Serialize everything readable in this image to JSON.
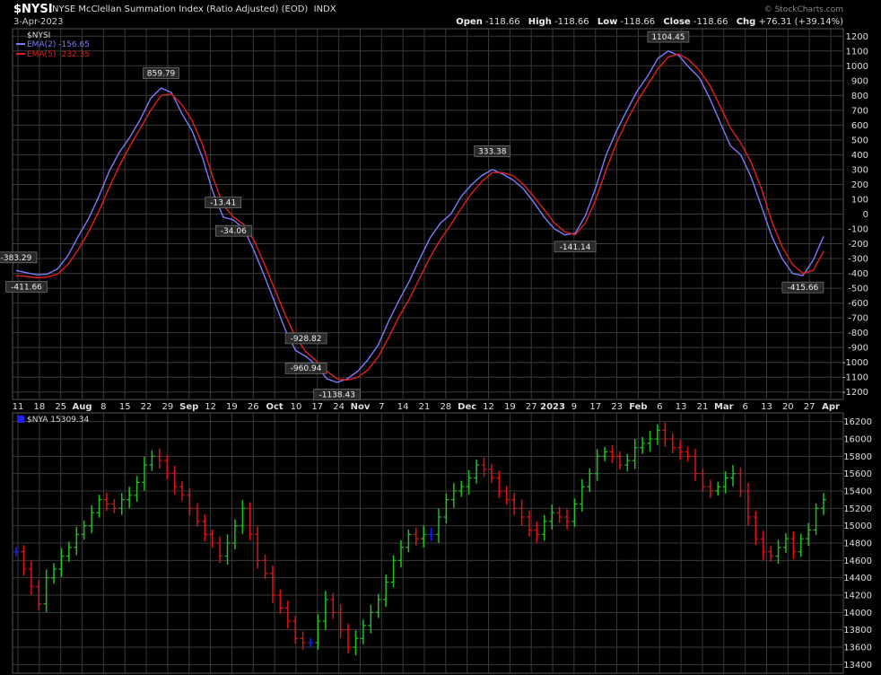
{
  "header": {
    "symbol": "$NYSI",
    "title": "NYSE McClellan Summation Index (Ratio Adjusted) (EOD)",
    "exchange": "INDX",
    "date": "3-Apr-2023",
    "brand": "© StockCharts.com",
    "ohlc": {
      "open_label": "Open",
      "open": "-118.66",
      "high_label": "High",
      "high": "-118.66",
      "low_label": "Low",
      "low": "-118.66",
      "close_label": "Close",
      "close": "-118.66",
      "chg_label": "Chg",
      "chg": "+76.31 (+39.14%)"
    }
  },
  "colors": {
    "background": "#000000",
    "grid": "#3a3a3a",
    "ema2": "#7b7bff",
    "ema5": "#e02020",
    "bar_up": "#20c020",
    "bar_down": "#e01010",
    "bar_neutral": "#2020ff"
  },
  "chart_data": [
    {
      "type": "line",
      "legend": [
        "$NYSI",
        "EMA(2) -156.65",
        "EMA(5) -232.35"
      ],
      "legend_position": "top-left",
      "grid": true,
      "ylim": [
        -1250,
        1250
      ],
      "yticks": [
        1200,
        1100,
        1000,
        900,
        800,
        700,
        600,
        500,
        400,
        300,
        200,
        100,
        0,
        -100,
        -200,
        -300,
        -400,
        -500,
        -600,
        -700,
        -800,
        -900,
        -1000,
        -1100,
        -1200
      ],
      "xticks": [
        "11",
        "18",
        "25",
        "Aug",
        "8",
        "15",
        "22",
        "29",
        "Sep",
        "12",
        "19",
        "26",
        "Oct",
        "10",
        "17",
        "24",
        "Nov",
        "7",
        "14",
        "21",
        "28",
        "Dec",
        "12",
        "19",
        "27",
        "2023",
        "9",
        "17",
        "23",
        "Feb",
        "6",
        "13",
        "21",
        "Mar",
        "6",
        "13",
        "20",
        "27",
        "Apr"
      ],
      "series": [
        {
          "name": "EMA(2)",
          "color": "#7b7bff",
          "values": [
            -380,
            -395,
            -410,
            -405,
            -370,
            -280,
            -150,
            -30,
            120,
            290,
            420,
            520,
            640,
            780,
            850,
            820,
            680,
            560,
            380,
            150,
            -20,
            -40,
            -100,
            -250,
            -420,
            -600,
            -780,
            -920,
            -960,
            -1020,
            -1110,
            -1135,
            -1110,
            -1060,
            -980,
            -880,
            -720,
            -580,
            -450,
            -300,
            -160,
            -60,
            0,
            120,
            200,
            260,
            300,
            270,
            230,
            170,
            80,
            -20,
            -100,
            -140,
            -130,
            -10,
            180,
            400,
            560,
            700,
            830,
            930,
            1050,
            1100,
            1070,
            990,
            920,
            780,
            620,
            460,
            400,
            250,
            50,
            -150,
            -300,
            -400,
            -415,
            -310,
            -150
          ]
        },
        {
          "name": "EMA(5)",
          "color": "#e02020",
          "values": [
            -415,
            -420,
            -430,
            -425,
            -405,
            -340,
            -240,
            -120,
            20,
            180,
            330,
            460,
            580,
            700,
            800,
            810,
            740,
            630,
            470,
            250,
            60,
            -20,
            -70,
            -180,
            -340,
            -510,
            -680,
            -830,
            -930,
            -990,
            -1060,
            -1110,
            -1120,
            -1100,
            -1050,
            -960,
            -830,
            -690,
            -570,
            -430,
            -290,
            -170,
            -70,
            40,
            140,
            220,
            280,
            280,
            260,
            200,
            120,
            30,
            -60,
            -120,
            -140,
            -60,
            100,
            300,
            480,
            630,
            760,
            870,
            980,
            1060,
            1080,
            1040,
            970,
            870,
            730,
            580,
            480,
            350,
            170,
            -50,
            -220,
            -340,
            -400,
            -380,
            -250
          ]
        }
      ],
      "annotations": [
        "-383.29",
        "-411.66",
        "859.79",
        "-13.41",
        "-34.06",
        "-928.82",
        "-960.94",
        "-1138.43",
        "333.38",
        "-141.14",
        "1104.45",
        "-415.66"
      ]
    },
    {
      "type": "bar",
      "legend": [
        "$NYA 15309.34"
      ],
      "legend_position": "top-left",
      "grid": true,
      "ylim": [
        13300,
        16300
      ],
      "yticks": [
        16200,
        16000,
        15800,
        15600,
        15400,
        15200,
        15000,
        14800,
        14600,
        14400,
        14200,
        14000,
        13800,
        13600,
        13400
      ],
      "close_values": [
        14700,
        14500,
        14300,
        14100,
        14400,
        14500,
        14650,
        14750,
        14900,
        15000,
        15150,
        15300,
        15250,
        15200,
        15300,
        15350,
        15500,
        15700,
        15800,
        15750,
        15600,
        15450,
        15350,
        15200,
        15050,
        14900,
        14800,
        14650,
        14800,
        15000,
        15200,
        14900,
        14600,
        14450,
        14200,
        14050,
        13900,
        13700,
        13650,
        13650,
        13900,
        14150,
        14000,
        13800,
        13600,
        13700,
        13850,
        14000,
        14150,
        14350,
        14600,
        14750,
        14900,
        14850,
        14900,
        14900,
        15100,
        15300,
        15400,
        15450,
        15550,
        15700,
        15650,
        15550,
        15400,
        15300,
        15200,
        15100,
        14950,
        14900,
        15050,
        15150,
        15100,
        15050,
        15250,
        15450,
        15600,
        15800,
        15850,
        15800,
        15700,
        15750,
        15900,
        15950,
        16000,
        16100,
        16000,
        15900,
        15850,
        15800,
        15600,
        15450,
        15400,
        15450,
        15550,
        15600,
        15400,
        15100,
        14850,
        14700,
        14650,
        14750,
        14850,
        14700,
        14850,
        14950,
        15200,
        15300
      ]
    }
  ]
}
